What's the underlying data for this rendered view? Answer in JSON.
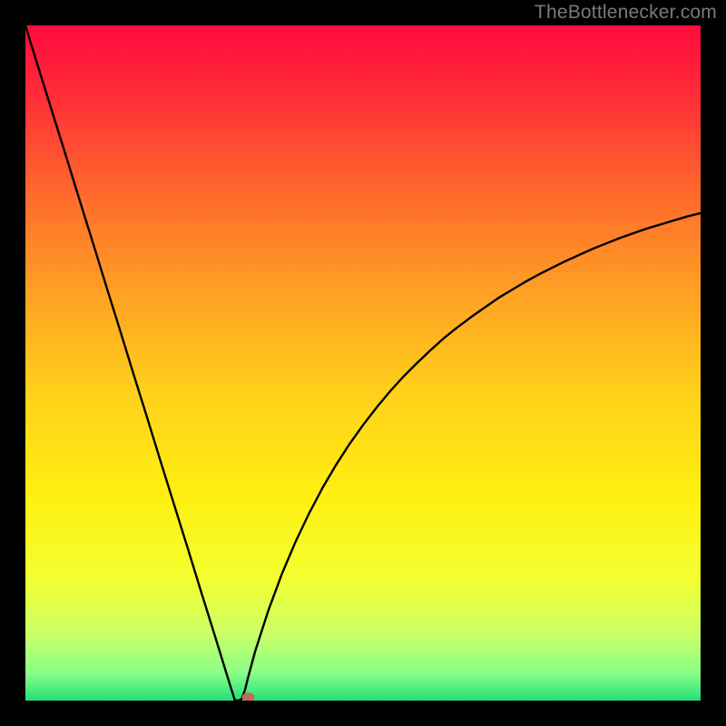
{
  "watermark": {
    "text": "TheBottlenecker.com"
  },
  "chart_data": {
    "type": "line",
    "title": "",
    "xlabel": "",
    "ylabel": "",
    "xlim": [
      0,
      100
    ],
    "ylim": [
      0,
      100
    ],
    "x": [
      0,
      2,
      4,
      6,
      8,
      10,
      12,
      14,
      16,
      18,
      20,
      22,
      24,
      26,
      28,
      30,
      31,
      31.5,
      32,
      32.5,
      33,
      34,
      36,
      38,
      40,
      42,
      44,
      46,
      48,
      50,
      52,
      54,
      56,
      58,
      60,
      62,
      64,
      66,
      68,
      70,
      72,
      74,
      76,
      78,
      80,
      82,
      84,
      86,
      88,
      90,
      92,
      94,
      96,
      98,
      100
    ],
    "y": [
      100,
      93.5,
      87.1,
      80.7,
      74.2,
      67.8,
      61.3,
      54.9,
      48.4,
      42.0,
      35.5,
      29.1,
      22.7,
      16.2,
      9.8,
      3.3,
      0.1,
      0.0,
      0.2,
      1.5,
      3.5,
      7.2,
      13.4,
      18.8,
      23.5,
      27.7,
      31.5,
      34.9,
      38.0,
      40.8,
      43.4,
      45.8,
      48.0,
      50.0,
      51.9,
      53.7,
      55.3,
      56.8,
      58.2,
      59.6,
      60.8,
      62.0,
      63.1,
      64.1,
      65.1,
      66.0,
      66.9,
      67.7,
      68.5,
      69.2,
      69.9,
      70.5,
      71.1,
      71.7,
      72.2
    ],
    "marker": {
      "x": 33.0,
      "y": 0.5
    },
    "gradient_bands": [
      {
        "stop": 0.0,
        "color": "#ff0b3d"
      },
      {
        "stop": 0.1,
        "color": "#ff2b38"
      },
      {
        "stop": 0.25,
        "color": "#ff6a2c"
      },
      {
        "stop": 0.4,
        "color": "#ffa224"
      },
      {
        "stop": 0.55,
        "color": "#ffd21a"
      },
      {
        "stop": 0.7,
        "color": "#fff010"
      },
      {
        "stop": 0.82,
        "color": "#f2ff30"
      },
      {
        "stop": 0.9,
        "color": "#ccff66"
      },
      {
        "stop": 0.96,
        "color": "#88ff88"
      },
      {
        "stop": 1.0,
        "color": "#22e07a"
      }
    ]
  }
}
